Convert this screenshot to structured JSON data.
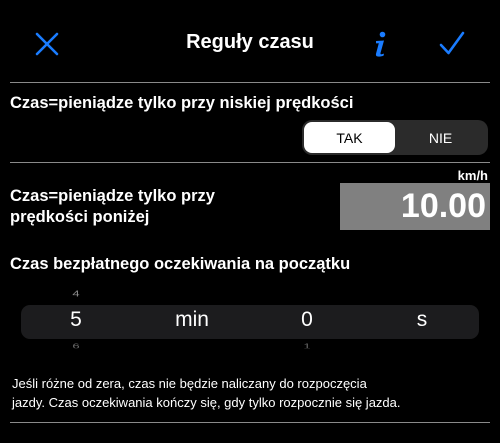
{
  "header": {
    "title": "Reguły czasu"
  },
  "section_slow_speed": {
    "label": "Czas=pieniądze tylko przy niskiej prędkości",
    "options": [
      "TAK",
      "NIE"
    ],
    "selected": "TAK"
  },
  "section_speed_threshold": {
    "label_line1": "Czas=pieniądze tylko przy",
    "label_line2": "prędkości poniżej",
    "unit": "km/h",
    "value": "10.00"
  },
  "section_free_wait": {
    "label": "Czas bezpłatnego oczekiwania na początku",
    "picker": {
      "minutes": {
        "prev": "4",
        "current": "5",
        "next": "6",
        "unit": "min"
      },
      "seconds": {
        "prev": "",
        "current": "0",
        "next": "1",
        "unit": "s"
      }
    }
  },
  "footnote": {
    "line1": "Jeśli różne od zera, czas nie będzie naliczany do rozpoczęcia",
    "line2": "jazdy. Czas oczekiwania kończy się, gdy tylko rozpocznie się jazda."
  },
  "icons": {
    "close": "close-icon",
    "info": "info-icon",
    "done": "checkmark-icon"
  },
  "colors": {
    "accent": "#1a7cff",
    "background": "#000000",
    "field": "#808080"
  }
}
